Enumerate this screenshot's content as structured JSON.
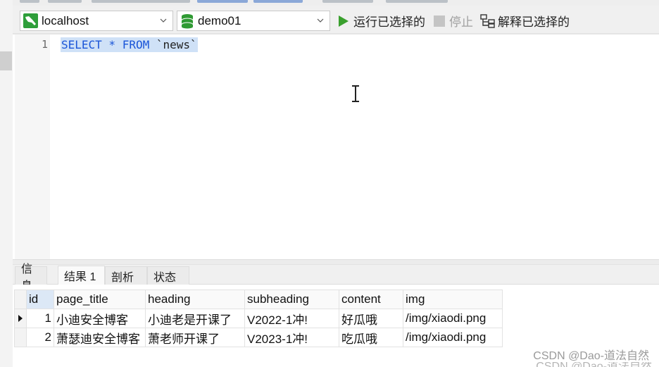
{
  "toolbar": {
    "connection": {
      "value": "localhost",
      "icon": "mysql-dolphin-icon"
    },
    "database": {
      "value": "demo01",
      "icon": "database-icon"
    },
    "run_selected_label": "运行已选择的",
    "stop_label": "停止",
    "explain_selected_label": "解释已选择的"
  },
  "editor": {
    "lines": [
      {
        "number": "1",
        "tokens": [
          {
            "text": "SELECT",
            "type": "keyword"
          },
          {
            "text": " * ",
            "type": "keyword"
          },
          {
            "text": "FROM",
            "type": "keyword"
          },
          {
            "text": " `news`",
            "type": "identifier"
          }
        ],
        "selected": true
      }
    ]
  },
  "result_tabs": [
    {
      "label": "信息",
      "active": false
    },
    {
      "label": "结果 1",
      "active": true
    },
    {
      "label": "剖析",
      "active": false
    },
    {
      "label": "状态",
      "active": false
    }
  ],
  "grid": {
    "columns": [
      "id",
      "page_title",
      "heading",
      "subheading",
      "content",
      "img"
    ],
    "rows": [
      {
        "current": true,
        "cells": [
          "1",
          "小迪安全博客",
          "小迪老是开课了",
          "V2022-1冲!",
          "好瓜哦",
          "/img/xiaodi.png"
        ]
      },
      {
        "current": false,
        "cells": [
          "2",
          "萧瑟迪安全博客",
          "萧老师开课了",
          "V2023-1冲!",
          "吃瓜哦",
          "/img/xiaodi.png"
        ]
      }
    ]
  },
  "watermark": "CSDN @Dao-道法自然",
  "colors": {
    "run_green": "#3aa02e",
    "keyword_blue": "#1a55d8",
    "selection_bg": "#cfe1f7",
    "stop_gray": "#a0a0a0"
  }
}
